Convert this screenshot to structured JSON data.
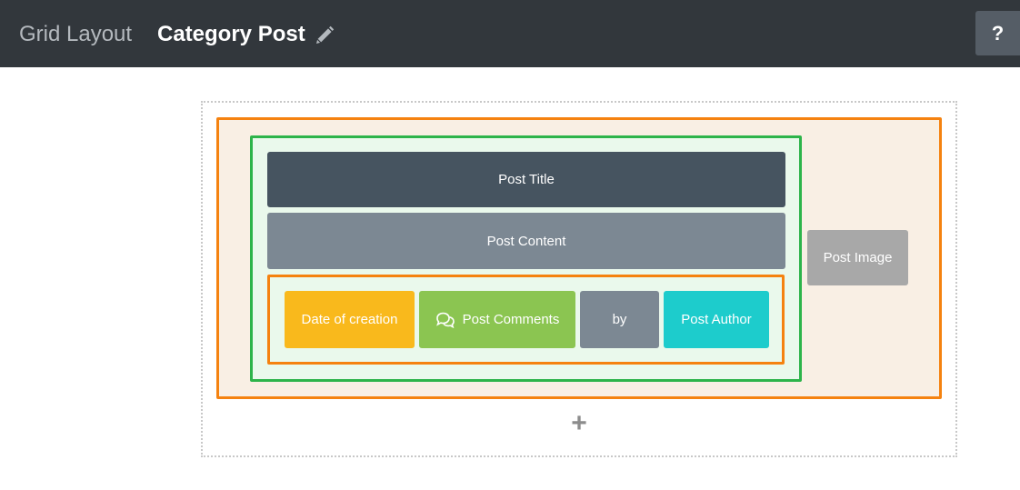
{
  "header": {
    "app_name": "Grid Layout",
    "title": "Category Post",
    "help_label": "?"
  },
  "grid": {
    "blocks": {
      "post_title": "Post Title",
      "post_content": "Post Content",
      "date": "Date of creation",
      "comments": "Post Comments",
      "by": "by",
      "author": "Post Author",
      "post_image": "Post Image"
    },
    "add_label": "+"
  },
  "icons": {
    "edit": "pencil-icon",
    "comments": "comments-icon"
  },
  "colors": {
    "header_bg": "#32373c",
    "row_border": "#f5820f",
    "column_border": "#2db44a",
    "post_title_bg": "#465460",
    "post_content_bg": "#7c8893",
    "date_bg": "#f9b91c",
    "comments_bg": "#8bc551",
    "author_bg": "#1dcccc",
    "image_bg": "#a8a8a8"
  }
}
